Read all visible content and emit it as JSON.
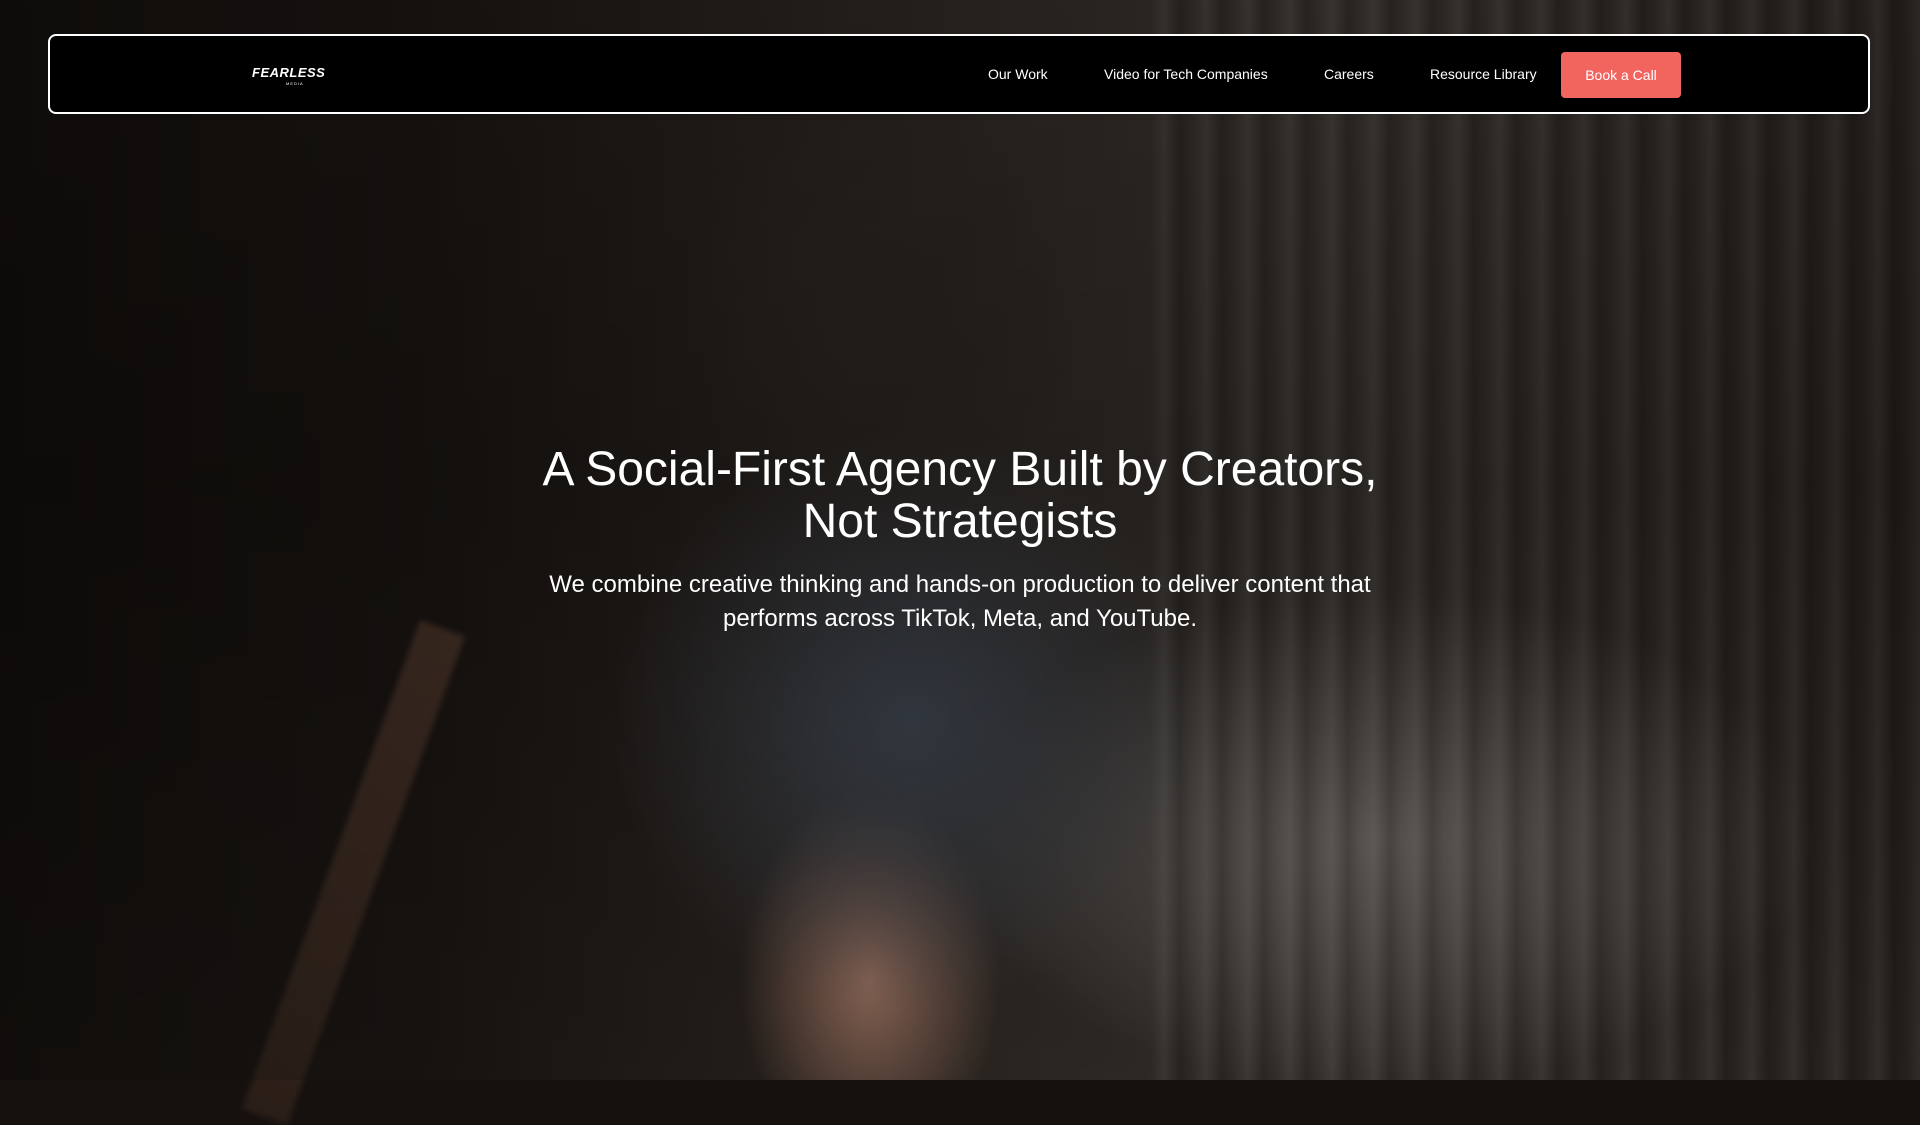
{
  "nav": {
    "logo_text": "FEARLESS",
    "logo_subtext": "MEDIA",
    "links": [
      "Our Work",
      "Video for Tech Companies",
      "Careers",
      "Resource Library"
    ],
    "cta_label": "Book a Call"
  },
  "hero": {
    "title_line1": "A Social-First Agency Built by Creators,",
    "title_line2": "Not Strategists",
    "subtitle_line1": "We combine creative thinking and hands-on production to deliver content that",
    "subtitle_line2": "performs across TikTok, Meta, and YouTube."
  },
  "colors": {
    "accent": "#f2655f",
    "nav_background": "#000000",
    "nav_border": "#ffffff"
  }
}
